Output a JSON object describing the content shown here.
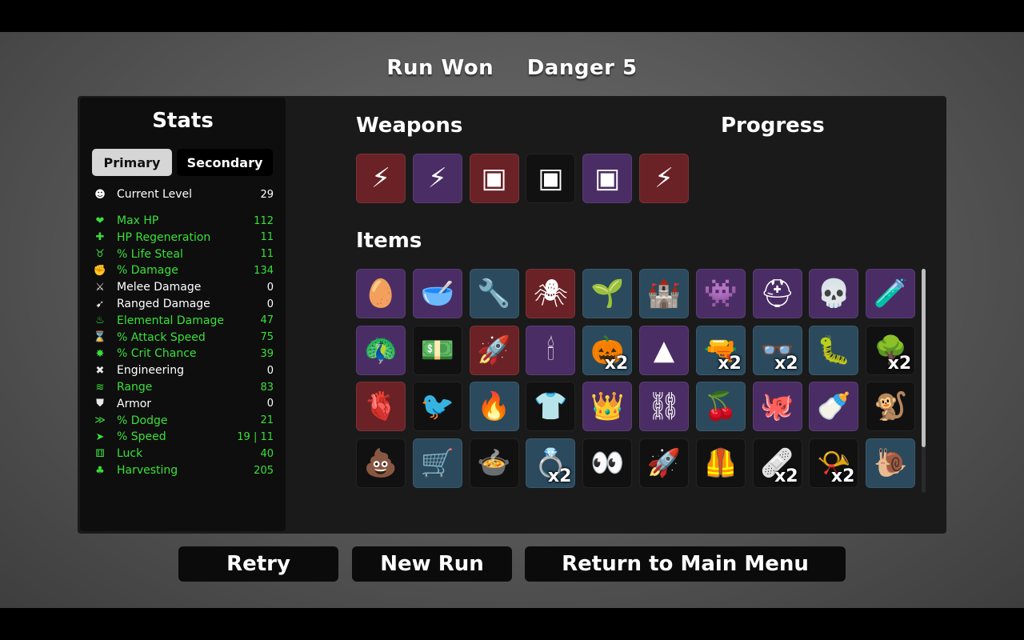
{
  "header": {
    "result": "Run Won",
    "danger": "Danger 5"
  },
  "stats": {
    "title": "Stats",
    "tabs": {
      "primary": "Primary",
      "secondary": "Secondary"
    },
    "current_level": {
      "label": "Current Level",
      "value": "29"
    },
    "rows": [
      {
        "label": "Max HP",
        "value": "112",
        "color": "#39e03a",
        "icon": "heart-icon",
        "glyph": "❤"
      },
      {
        "label": "HP Regeneration",
        "value": "11",
        "color": "#39e03a",
        "icon": "heart-plus-icon",
        "glyph": "✚"
      },
      {
        "label": "% Life Steal",
        "value": "11",
        "color": "#39e03a",
        "icon": "fangs-icon",
        "glyph": "♉"
      },
      {
        "label": "% Damage",
        "value": "134",
        "color": "#39e03a",
        "icon": "muscle-icon",
        "glyph": "✊"
      },
      {
        "label": "Melee Damage",
        "value": "0",
        "color": "#ffffff",
        "icon": "sword-icon",
        "glyph": "⚔"
      },
      {
        "label": "Ranged Damage",
        "value": "0",
        "color": "#ffffff",
        "icon": "bow-icon",
        "glyph": "➹"
      },
      {
        "label": "Elemental Damage",
        "value": "47",
        "color": "#39e03a",
        "icon": "flame-icon",
        "glyph": "♨"
      },
      {
        "label": "% Attack Speed",
        "value": "75",
        "color": "#39e03a",
        "icon": "hourglass-icon",
        "glyph": "⌛"
      },
      {
        "label": "% Crit Chance",
        "value": "39",
        "color": "#39e03a",
        "icon": "crit-burst-icon",
        "glyph": "✸"
      },
      {
        "label": "Engineering",
        "value": "0",
        "color": "#ffffff",
        "icon": "wrench-icon",
        "glyph": "✖"
      },
      {
        "label": "Range",
        "value": "83",
        "color": "#39e03a",
        "icon": "range-wave-icon",
        "glyph": "≋"
      },
      {
        "label": "Armor",
        "value": "0",
        "color": "#ffffff",
        "icon": "shield-icon",
        "glyph": "⛊"
      },
      {
        "label": "% Dodge",
        "value": "21",
        "color": "#39e03a",
        "icon": "dodge-wind-icon",
        "glyph": "≫"
      },
      {
        "label": "% Speed",
        "value": "19 | 11",
        "color": "#39e03a",
        "icon": "boot-icon",
        "glyph": "➤"
      },
      {
        "label": "Luck",
        "value": "40",
        "color": "#39e03a",
        "icon": "dice-icon",
        "glyph": "⚅"
      },
      {
        "label": "Harvesting",
        "value": "205",
        "color": "#39e03a",
        "icon": "wheat-icon",
        "glyph": "♣"
      }
    ]
  },
  "weapons": {
    "title": "Weapons",
    "items": [
      {
        "name": "lightning-wand-weapon-icon",
        "tier": "red",
        "glyph": "⚡"
      },
      {
        "name": "spark-spear-weapon-icon",
        "tier": "purple",
        "glyph": "⚡"
      },
      {
        "name": "taser-weapon-icon",
        "tier": "red",
        "glyph": "▣"
      },
      {
        "name": "taser-weapon-icon",
        "tier": "black",
        "glyph": "▣"
      },
      {
        "name": "taser-weapon-icon",
        "tier": "purple",
        "glyph": "▣"
      },
      {
        "name": "lightning-wand-weapon-icon",
        "tier": "red",
        "glyph": "⚡"
      }
    ]
  },
  "progress": {
    "title": "Progress"
  },
  "items": {
    "title": "Items",
    "grid": [
      {
        "name": "egg-item-icon",
        "tier": "purple",
        "glyph": "🥚",
        "qty": ""
      },
      {
        "name": "mortar-item-icon",
        "tier": "purple",
        "glyph": "🥣",
        "qty": ""
      },
      {
        "name": "wrench-drill-item-icon",
        "tier": "blue",
        "glyph": "🔧",
        "qty": ""
      },
      {
        "name": "spider-item-icon",
        "tier": "red",
        "glyph": "🕷",
        "qty": ""
      },
      {
        "name": "garden-item-icon",
        "tier": "blue",
        "glyph": "🌱",
        "qty": ""
      },
      {
        "name": "tower-item-icon",
        "tier": "blue",
        "glyph": "🏰",
        "qty": ""
      },
      {
        "name": "alien-horns-item-icon",
        "tier": "purple",
        "glyph": "👾",
        "qty": ""
      },
      {
        "name": "helmet-item-icon",
        "tier": "purple",
        "glyph": "⛑",
        "qty": ""
      },
      {
        "name": "skull-pile-item-icon",
        "tier": "purple",
        "glyph": "💀",
        "qty": ""
      },
      {
        "name": "potion-bag-item-icon",
        "tier": "purple",
        "glyph": "🧪",
        "qty": ""
      },
      {
        "name": "peacock-item-icon",
        "tier": "purple",
        "glyph": "🦚",
        "qty": ""
      },
      {
        "name": "banknote-item-icon",
        "tier": "black",
        "glyph": "💵",
        "qty": ""
      },
      {
        "name": "rockets-item-icon",
        "tier": "red",
        "glyph": "🚀",
        "qty": ""
      },
      {
        "name": "candle-item-icon",
        "tier": "purple",
        "glyph": "🕯",
        "qty": ""
      },
      {
        "name": "pumpkin-item-icon",
        "tier": "blue",
        "glyph": "🎃",
        "qty": "x2"
      },
      {
        "name": "triangle-item-icon",
        "tier": "purple",
        "glyph": "▲",
        "qty": ""
      },
      {
        "name": "bullet-item-icon",
        "tier": "blue",
        "glyph": "🔫",
        "qty": "x2"
      },
      {
        "name": "glasses-item-icon",
        "tier": "blue",
        "glyph": "👓",
        "qty": "x2"
      },
      {
        "name": "worm-item-icon",
        "tier": "blue",
        "glyph": "🐛",
        "qty": ""
      },
      {
        "name": "tree-item-icon",
        "tier": "black",
        "glyph": "🌳",
        "qty": "x2"
      },
      {
        "name": "stomach-item-icon",
        "tier": "red",
        "glyph": "🫀",
        "qty": ""
      },
      {
        "name": "bird-head-item-icon",
        "tier": "black",
        "glyph": "🐦",
        "qty": ""
      },
      {
        "name": "campfire-item-icon",
        "tier": "blue",
        "glyph": "🔥",
        "qty": ""
      },
      {
        "name": "flannel-shirt-item-icon",
        "tier": "black",
        "glyph": "👕",
        "qty": ""
      },
      {
        "name": "crown-item-icon",
        "tier": "purple",
        "glyph": "👑",
        "qty": ""
      },
      {
        "name": "handcuffs-item-icon",
        "tier": "purple",
        "glyph": "⛓",
        "qty": ""
      },
      {
        "name": "cherries-item-icon",
        "tier": "blue",
        "glyph": "🍒",
        "qty": ""
      },
      {
        "name": "tentacle-item-icon",
        "tier": "purple",
        "glyph": "🐙",
        "qty": ""
      },
      {
        "name": "bottle-item-icon",
        "tier": "purple",
        "glyph": "🍼",
        "qty": ""
      },
      {
        "name": "monkey-item-icon",
        "tier": "black",
        "glyph": "🐒",
        "qty": ""
      },
      {
        "name": "poop-item-icon",
        "tier": "black",
        "glyph": "💩",
        "qty": ""
      },
      {
        "name": "wheelbarrow-item-icon",
        "tier": "blue",
        "glyph": "🛒",
        "qty": ""
      },
      {
        "name": "cauldron-item-icon",
        "tier": "black",
        "glyph": "🍲",
        "qty": ""
      },
      {
        "name": "ring-item-icon",
        "tier": "blue",
        "glyph": "💍",
        "qty": "x2"
      },
      {
        "name": "eyes-item-icon",
        "tier": "black",
        "glyph": "👀",
        "qty": ""
      },
      {
        "name": "rocket-item-icon",
        "tier": "black",
        "glyph": "🚀",
        "qty": ""
      },
      {
        "name": "vest-item-icon",
        "tier": "black",
        "glyph": "🦺",
        "qty": ""
      },
      {
        "name": "bandage-item-icon",
        "tier": "black",
        "glyph": "🩹",
        "qty": "x2"
      },
      {
        "name": "horn-item-icon",
        "tier": "black",
        "glyph": "📯",
        "qty": "x2"
      },
      {
        "name": "snail-item-icon",
        "tier": "blue",
        "glyph": "🐌",
        "qty": ""
      }
    ]
  },
  "buttons": {
    "retry": "Retry",
    "new_run": "New Run",
    "main_menu": "Return to Main Menu"
  }
}
